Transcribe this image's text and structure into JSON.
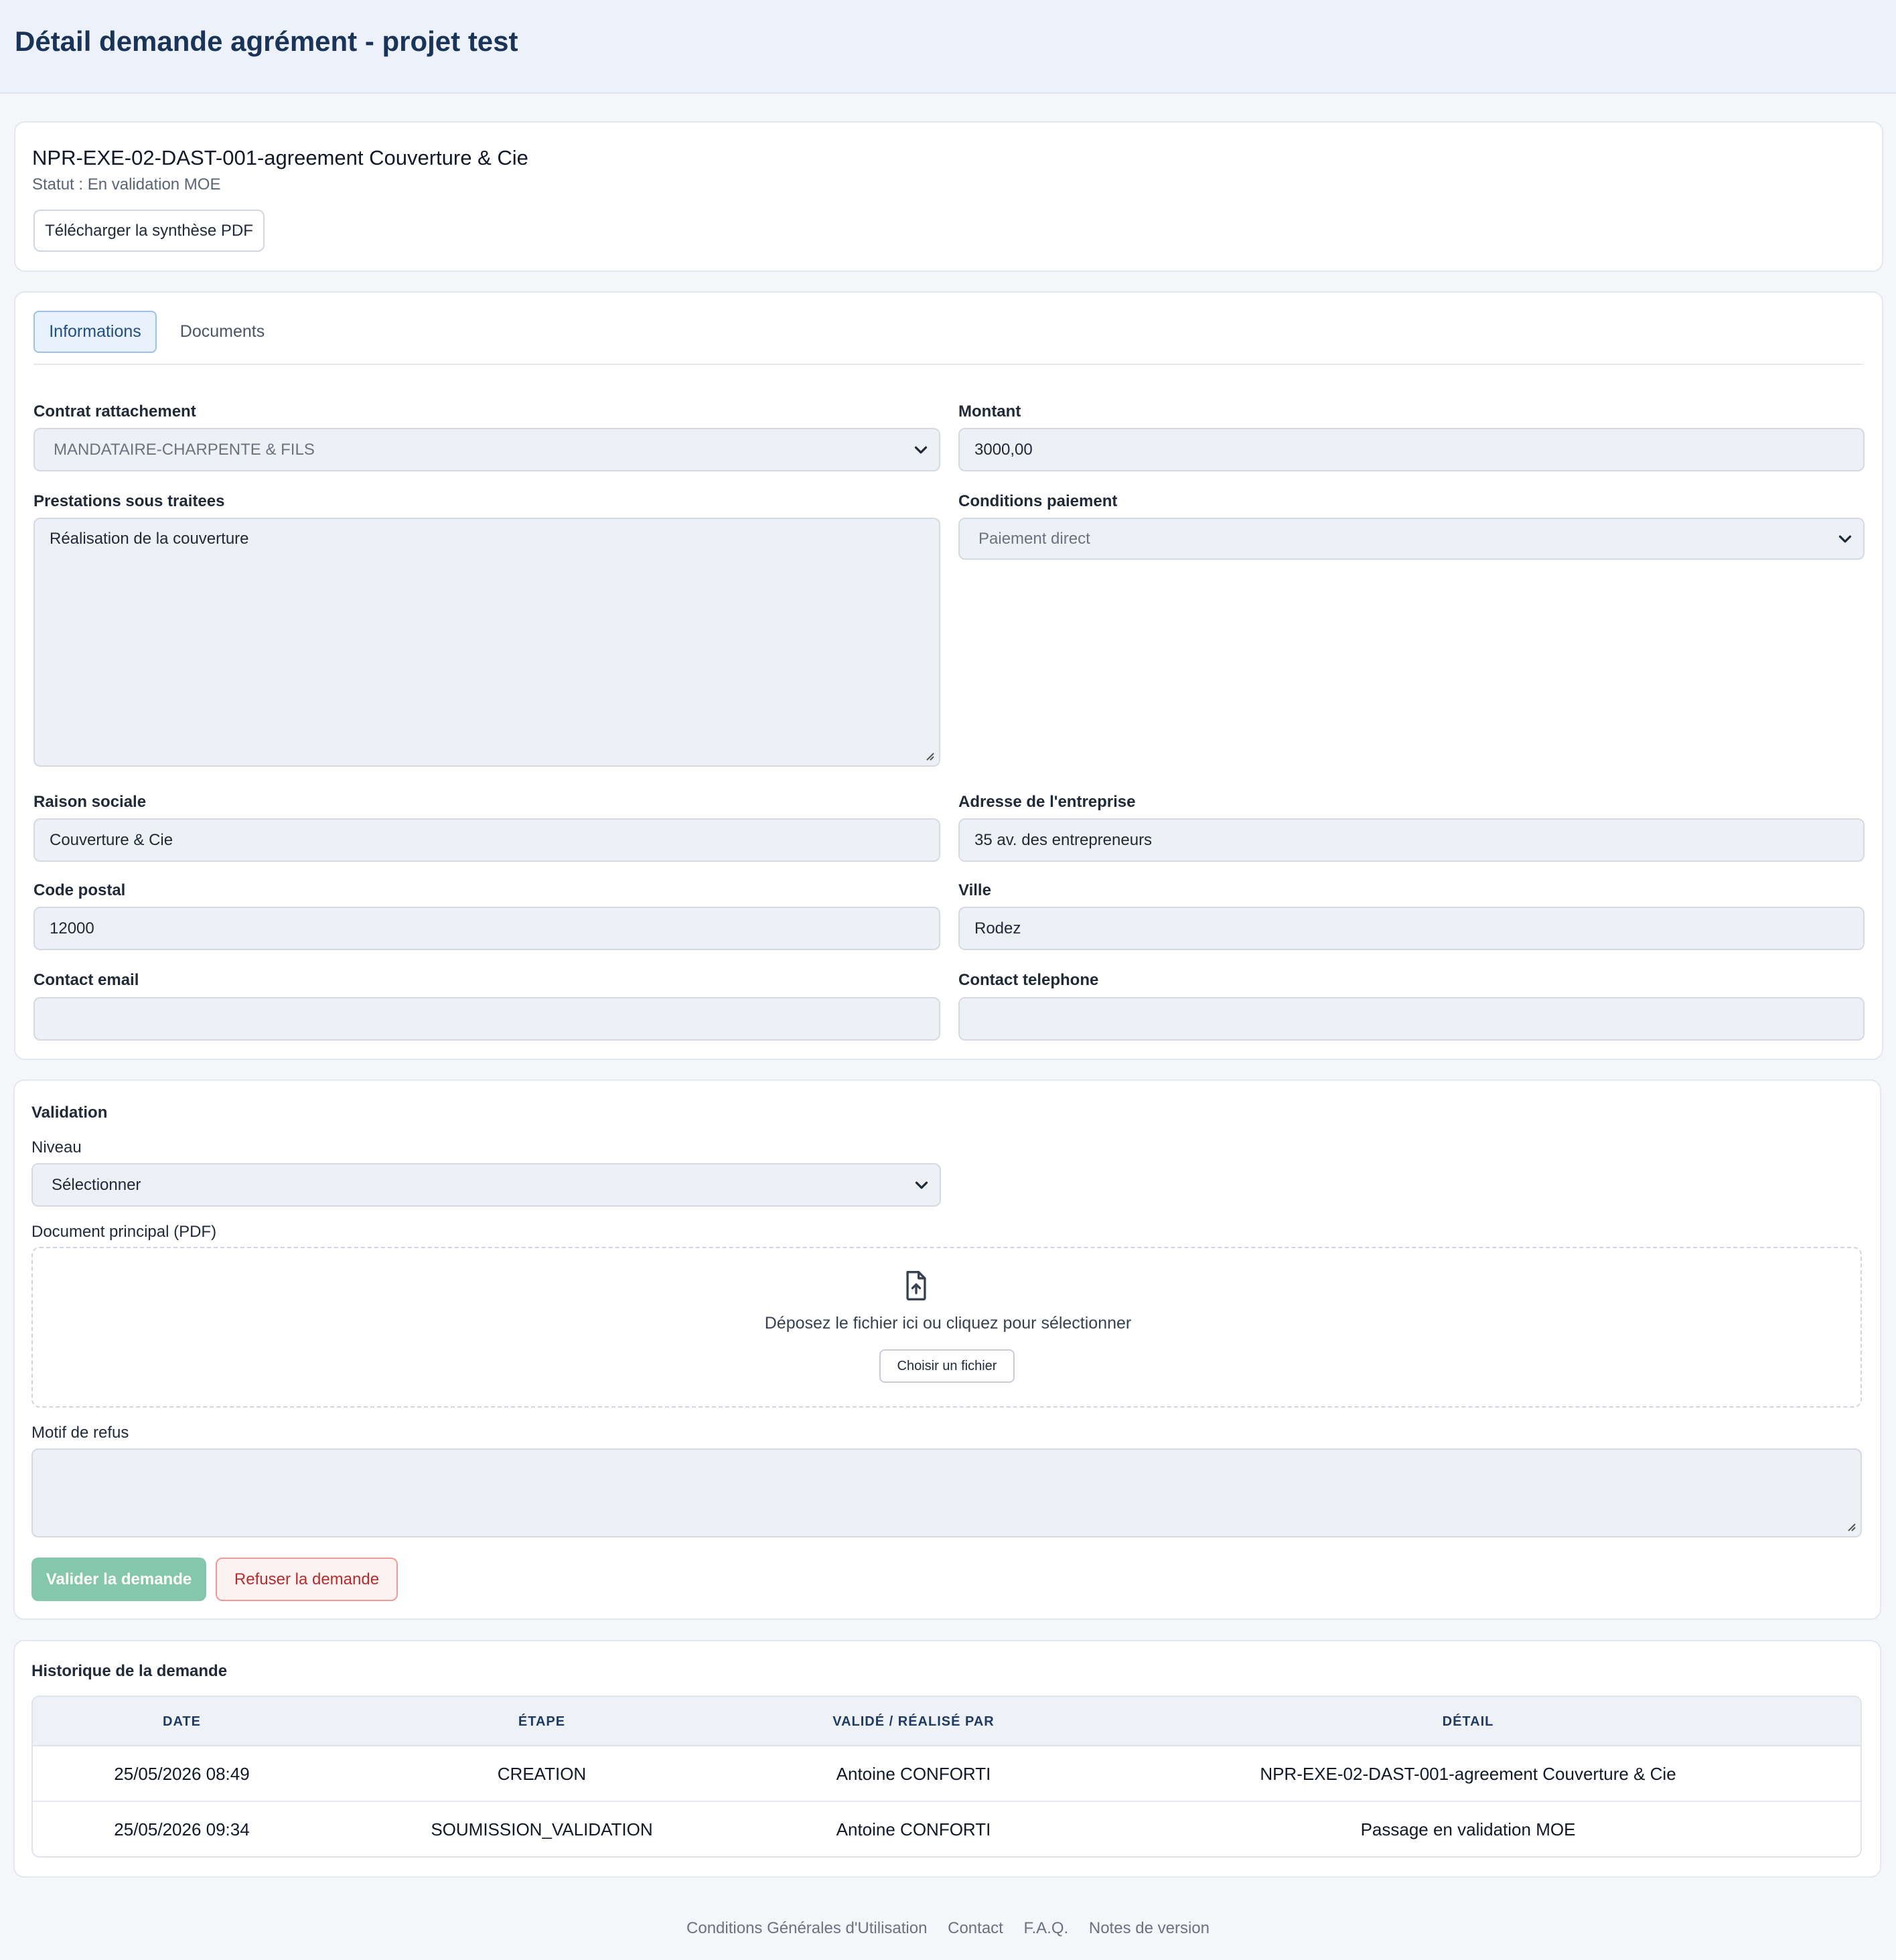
{
  "header": {
    "title": "Détail demande agrément - projet test"
  },
  "summary": {
    "title": "NPR-EXE-02-DAST-001-agreement Couverture & Cie",
    "status": "Statut : En validation MOE",
    "pdf_button": "Télécharger la synthèse PDF"
  },
  "tabs": [
    {
      "label": "Informations",
      "active": true
    },
    {
      "label": "Documents",
      "active": false
    }
  ],
  "form": {
    "contrat": {
      "label": "Contrat rattachement",
      "value": "MANDATAIRE-CHARPENTE & FILS"
    },
    "montant": {
      "label": "Montant",
      "value": "3000,00"
    },
    "prestations": {
      "label": "Prestations sous traitees",
      "value": "Réalisation de la couverture"
    },
    "conditions": {
      "label": "Conditions paiement",
      "value": "Paiement direct"
    },
    "raison": {
      "label": "Raison sociale",
      "value": "Couverture & Cie"
    },
    "adresse": {
      "label": "Adresse de l'entreprise",
      "value": "35 av. des entrepreneurs"
    },
    "code_postal": {
      "label": "Code postal",
      "value": "12000"
    },
    "ville": {
      "label": "Ville",
      "value": "Rodez"
    },
    "email": {
      "label": "Contact email",
      "value": ""
    },
    "telephone": {
      "label": "Contact telephone",
      "value": ""
    }
  },
  "validation": {
    "title": "Validation",
    "niveau_label": "Niveau",
    "niveau_value": "Sélectionner",
    "document_label": "Document principal (PDF)",
    "drop_text": "Déposez le fichier ici ou cliquez pour sélectionner",
    "choose_file": "Choisir un fichier",
    "motif_label": "Motif de refus",
    "motif_value": "",
    "validate_button": "Valider la demande",
    "refuse_button": "Refuser la demande"
  },
  "history": {
    "title": "Historique de la demande",
    "columns": [
      "DATE",
      "ÉTAPE",
      "VALIDÉ / RÉALISÉ PAR",
      "DÉTAIL"
    ],
    "rows": [
      [
        "25/05/2026 08:49",
        "CREATION",
        "Antoine CONFORTI",
        "NPR-EXE-02-DAST-001-agreement Couverture & Cie"
      ],
      [
        "25/05/2026 09:34",
        "SOUMISSION_VALIDATION",
        "Antoine CONFORTI",
        "Passage en validation MOE"
      ]
    ]
  },
  "footer": {
    "links": [
      "Conditions Générales d'Utilisation",
      "Contact",
      "F.A.Q.",
      "Notes de version"
    ]
  },
  "colors": {
    "title": "#1a3358",
    "validate_button": "#85c7ac",
    "refuse_text": "#b62b2b",
    "tab_active_bg": "#e8f1fc"
  },
  "icons": {
    "select_chevron": "chevron-down-icon",
    "upload": "file-upload-icon",
    "textarea_resize": "resize-handle-icon"
  }
}
